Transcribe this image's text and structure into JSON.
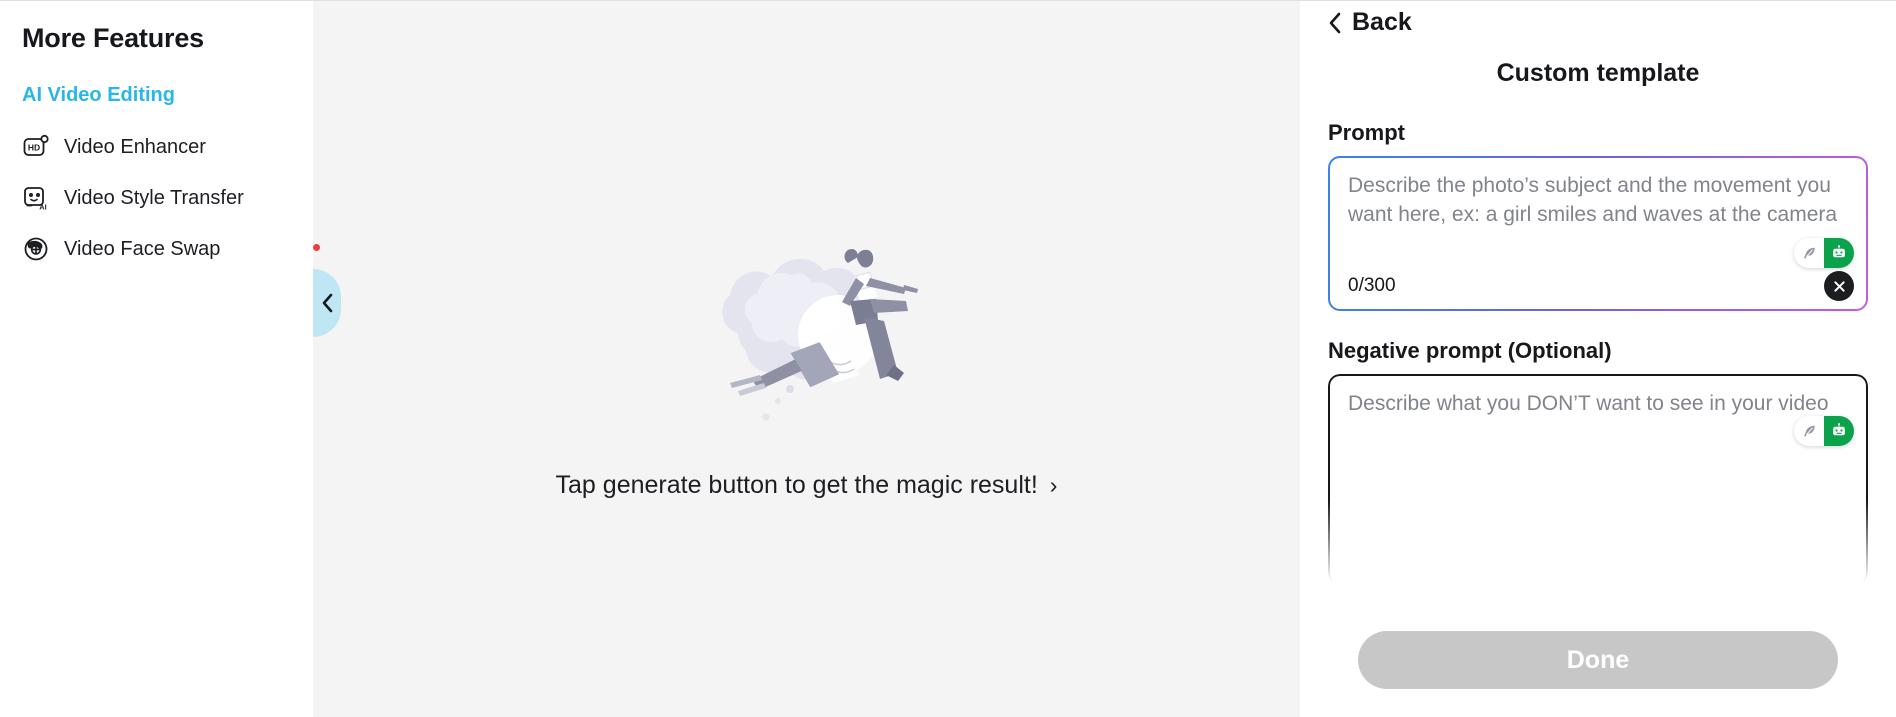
{
  "sidebar": {
    "title": "More Features",
    "section_label": "AI Video Editing",
    "items": [
      {
        "label": "Video Enhancer",
        "icon": "hd-badge-icon"
      },
      {
        "label": "Video Style Transfer",
        "icon": "ai-face-icon"
      },
      {
        "label": "Video Face Swap",
        "icon": "face-swap-icon"
      }
    ]
  },
  "center": {
    "magic_text": "Tap generate button to get the magic result!",
    "magic_chevron": "›",
    "collapse_icon": "chevron-left-icon"
  },
  "right_panel": {
    "back_label": "Back",
    "title": "Custom template",
    "prompt": {
      "label": "Prompt",
      "value": "",
      "placeholder": "Describe the photo’s subject and the movement you want here, ex: a girl smiles and waves at the camera",
      "counter": "0/300",
      "pill_left_icon": "feather-pen-icon",
      "pill_right_icon": "robot-icon",
      "clear_icon": "close-icon"
    },
    "negative_prompt": {
      "label": "Negative prompt (Optional)",
      "value": "",
      "placeholder": "Describe what you DON’T want to see in your video",
      "pill_left_icon": "feather-pen-icon",
      "pill_right_icon": "robot-icon"
    },
    "done_label": "Done"
  },
  "colors": {
    "accent_cyan": "#29b6e8",
    "gradient_start": "#3b82e8",
    "gradient_end": "#c45ce0",
    "robot_green": "#0aa24b",
    "collapse_tab": "#bfe6f4",
    "red_dot": "#e8413a",
    "done_disabled": "#c7c7c7",
    "center_bg": "#f4f4f5"
  }
}
